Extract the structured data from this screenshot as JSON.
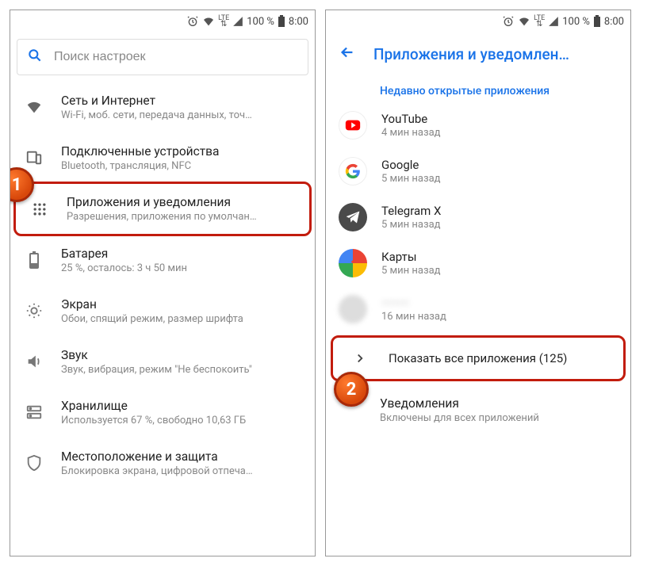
{
  "status": {
    "pct": "100 %",
    "time": "8:00",
    "net_label": "LTE"
  },
  "left": {
    "search_placeholder": "Поиск настроек",
    "items": [
      {
        "title": "Сеть и Интернет",
        "subtitle": "Wi-Fi, моб. сети, передача данных, точ…"
      },
      {
        "title": "Подключенные устройства",
        "subtitle": "Bluetooth, трансляция, NFC"
      },
      {
        "title": "Приложения и уведомления",
        "subtitle": "Разрешения, приложения по умолчан…"
      },
      {
        "title": "Батарея",
        "subtitle": "25 %, осталось: 3 ч 50 мин"
      },
      {
        "title": "Экран",
        "subtitle": "Обои, спящий режим, размер шрифта"
      },
      {
        "title": "Звук",
        "subtitle": "Звук, вибрация, режим \"Не беспокоить\""
      },
      {
        "title": "Хранилище",
        "subtitle": "Используется 67 %, свободно 10,63 ГБ"
      },
      {
        "title": "Местоположение и защита",
        "subtitle": "Блокировка экрана, цифровой отпеча…"
      }
    ]
  },
  "right": {
    "title": "Приложения и уведомлен…",
    "section": "Недавно открытые приложения",
    "apps": [
      {
        "name": "YouTube",
        "time": "4 мин назад"
      },
      {
        "name": "Google",
        "time": "5 мин назад"
      },
      {
        "name": "Telegram X",
        "time": "5 мин назад"
      },
      {
        "name": "Карты",
        "time": "5 мин назад"
      },
      {
        "name": "———",
        "time": "16 мин назад"
      }
    ],
    "show_all": "Показать все приложения (125)",
    "notif_title": "Уведомления",
    "notif_sub": "Включены для всех приложений"
  },
  "badges": {
    "one": "1",
    "two": "2"
  }
}
